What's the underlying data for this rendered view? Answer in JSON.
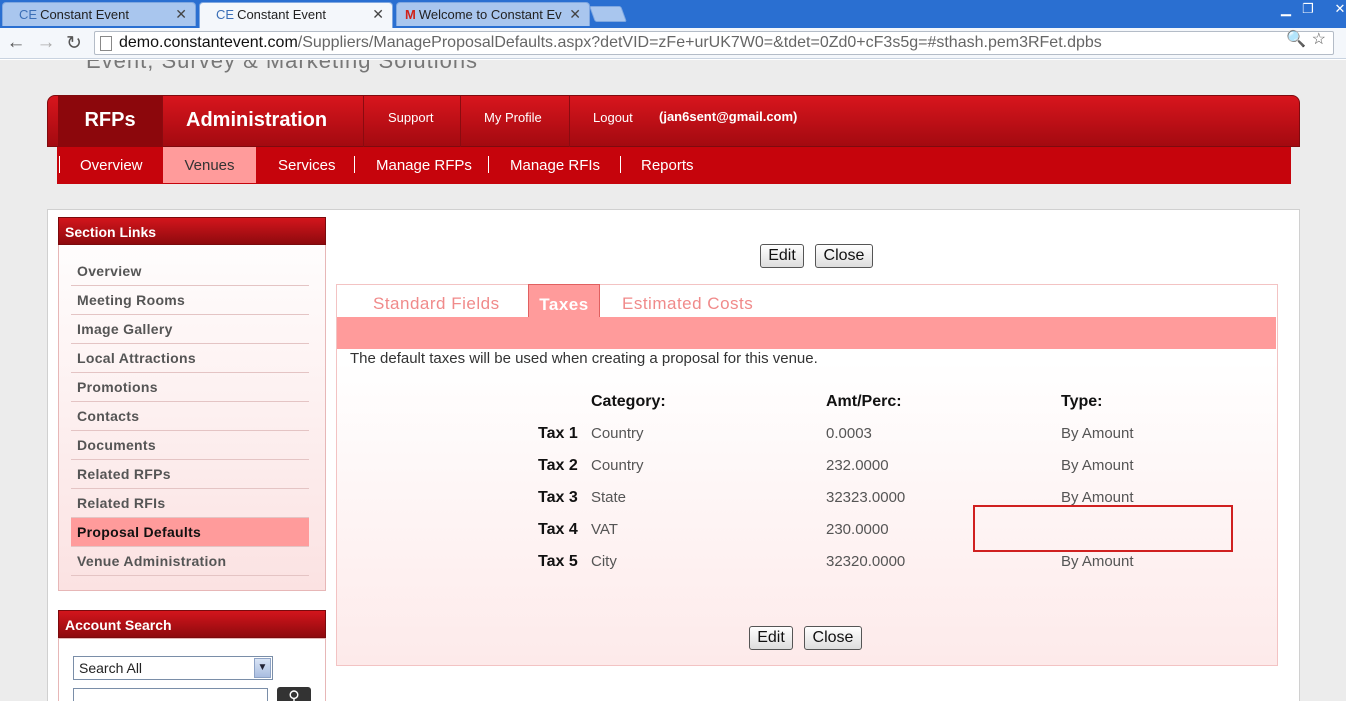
{
  "browser": {
    "tabs": [
      {
        "icon": "CE",
        "title": "Constant Event"
      },
      {
        "icon": "CE",
        "title": "Constant Event"
      },
      {
        "icon": "M",
        "title": "Welcome to Constant Ev"
      }
    ],
    "url_host": "demo.constantevent.com",
    "url_path": "/Suppliers/ManageProposalDefaults.aspx?detVID=zFe+urUK7W0=&tdet=0Zd0+cF3s5g=#sthash.pem3RFet.dpbs"
  },
  "header": {
    "tagline": "Event, Survey & Marketing Solutions",
    "rfps": "RFPs",
    "administration": "Administration",
    "support": "Support",
    "my_profile": "My Profile",
    "logout": "Logout",
    "email": "(jan6sent@gmail.com)"
  },
  "subnav": [
    "Overview",
    "Venues",
    "Services",
    "Manage RFPs",
    "Manage RFIs",
    "Reports"
  ],
  "sidebar": {
    "title": "Section Links",
    "links": [
      "Overview",
      "Meeting Rooms",
      "Image Gallery",
      "Local Attractions",
      "Promotions",
      "Contacts",
      "Documents",
      "Related RFPs",
      "Related RFIs",
      "Proposal Defaults",
      "Venue Administration"
    ],
    "active": "Proposal Defaults"
  },
  "account_search": {
    "title": "Account Search",
    "select_value": "Search All"
  },
  "main": {
    "edit": "Edit",
    "close": "Close",
    "tabs": [
      "Standard Fields",
      "Taxes",
      "Estimated Costs"
    ],
    "active_tab": "Taxes",
    "description": "The default taxes will be used when creating a proposal for this venue.",
    "headers": {
      "category": "Category:",
      "amount": "Amt/Perc:",
      "type": "Type:"
    },
    "taxes": [
      {
        "label": "Tax 1",
        "category": "Country",
        "amount": "0.0003",
        "type": "By Amount"
      },
      {
        "label": "Tax 2",
        "category": "Country",
        "amount": "232.0000",
        "type": "By Amount"
      },
      {
        "label": "Tax 3",
        "category": "State",
        "amount": "32323.0000",
        "type": "By Amount"
      },
      {
        "label": "Tax 4",
        "category": "VAT",
        "amount": "230.0000",
        "type": ""
      },
      {
        "label": "Tax 5",
        "category": "City",
        "amount": "32320.0000",
        "type": "By Amount"
      }
    ]
  },
  "colors": {
    "brand_red": "#c6040c",
    "active_pink": "#ff9b9b",
    "highlight_box": "#d02020"
  }
}
